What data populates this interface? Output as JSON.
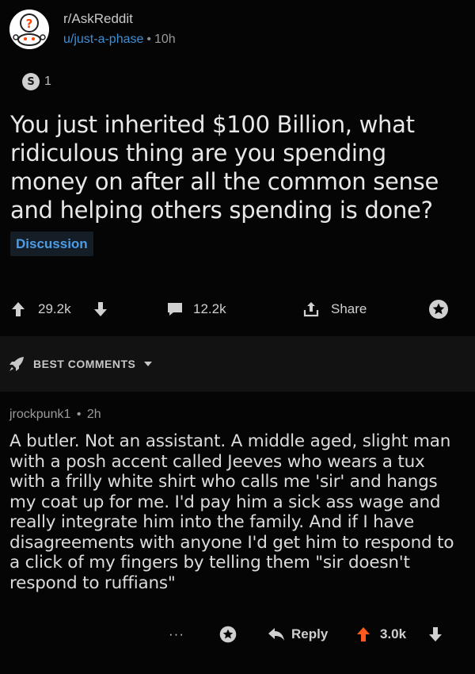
{
  "post": {
    "subreddit": "r/AskReddit",
    "author": "u/just-a-phase",
    "separator": "•",
    "time": "10h",
    "award": {
      "icon": "silver-award-icon",
      "symbol": "S",
      "count": "1"
    },
    "title": "You just inherited $100 Billion, what ridiculous thing are you spending money on after all the common sense and helping others spending is done?",
    "flair": "Discussion",
    "actions": {
      "upvote_icon": "upvote-arrow-icon",
      "score": "29.2k",
      "downvote_icon": "downvote-arrow-icon",
      "comment_icon": "comment-bubble-icon",
      "comments": "12.2k",
      "share_icon": "share-icon",
      "share_label": "Share",
      "save_icon": "star-icon"
    }
  },
  "sort": {
    "icon": "rocket-icon",
    "label": "BEST COMMENTS",
    "dropdown_icon": "caret-down-icon"
  },
  "comment": {
    "author": "jrockpunk1",
    "separator": "•",
    "time": "2h",
    "body": "A butler. Not an assistant. A middle aged, slight man with a posh accent called Jeeves who wears a tux with a frilly white shirt who calls me 'sir' and hangs my coat up for me. I'd pay him a sick ass wage and really integrate him into the family. And if I have disagreements with anyone I'd get him to respond to a click of my fingers by telling them \"sir doesn't respond to ruffians\"",
    "actions": {
      "more": "···",
      "save_icon": "star-icon",
      "reply_icon": "reply-arrow-icon",
      "reply_label": "Reply",
      "upvote_icon": "upvote-arrow-icon",
      "score": "3.0k",
      "downvote_icon": "downvote-arrow-icon"
    }
  },
  "colors": {
    "background": "#050505",
    "band": "#121212",
    "link_blue": "#3d8fd6",
    "flair_text": "#4a9de6",
    "upvoted_orange": "#ff5a1e",
    "text": "#e8e8e8"
  }
}
